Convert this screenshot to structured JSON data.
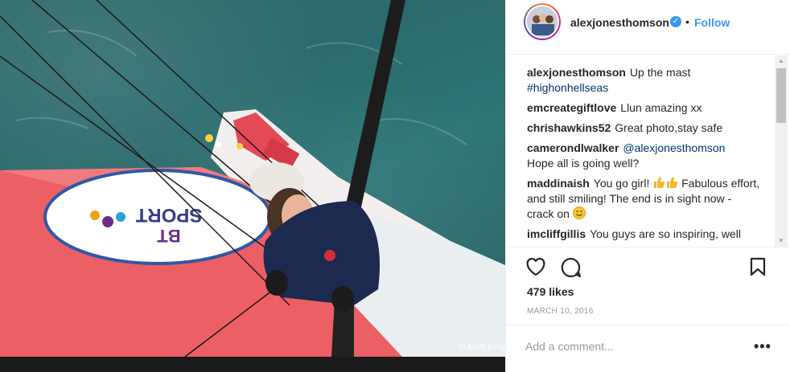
{
  "photo": {
    "credit": "© Matt Knig",
    "sail_logo_top": "BT",
    "sail_logo_text": "SPORT"
  },
  "post": {
    "username": "alexjonesthomson",
    "separator": "•",
    "follow_label": "Follow",
    "verified_icon": "verified-check-icon",
    "likes": "479 likes",
    "date": "MARCH 10, 2016",
    "comment_placeholder": "Add a comment...",
    "more_label": "•••"
  },
  "comments": [
    {
      "user": "alexjonesthomson",
      "text": "Up the mast",
      "link": "#highonhellseas"
    },
    {
      "user": "emcreategiftlove",
      "text": "Llun amazing xx"
    },
    {
      "user": "chrishawkins52",
      "text": "Great photo,stay safe"
    },
    {
      "user": "camerondlwalker",
      "link": "@alexjonesthomson",
      "text": "Hope all is going well?"
    },
    {
      "user": "maddinaish",
      "text_a": "You go girl!",
      "text_b": "Fabulous effort, and still smiling! The end is in sight now - crack on"
    },
    {
      "user": "imcliffgillis",
      "text": "You guys are so inspiring, well"
    }
  ],
  "colors": {
    "accent": "#3897f0",
    "link": "#003569",
    "text": "#262626",
    "muted": "#999999"
  }
}
